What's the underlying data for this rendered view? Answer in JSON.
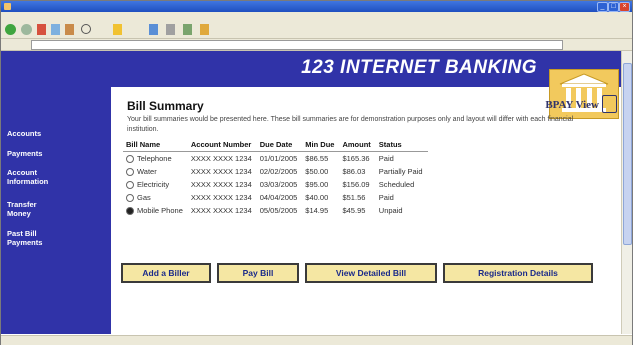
{
  "window": {
    "title": ""
  },
  "menu": [],
  "banner": {
    "title": "123 INTERNET BANKING"
  },
  "sidebar": {
    "items": [
      "Accounts",
      "Payments",
      "Account\nInformation",
      "Transfer\nMoney",
      "Past Bill\nPayments"
    ]
  },
  "main": {
    "heading": "Bill Summary",
    "bpay_label": "BPAY View",
    "description": "Your bill summaries would be presented here. These bill summaries are for demonstration purposes only and layout will differ with each financial institution."
  },
  "table": {
    "headers": [
      "Bill Name",
      "Account Number",
      "Due Date",
      "Min Due",
      "Amount",
      "Status"
    ],
    "rows": [
      {
        "name": "Telephone",
        "account": "XXXX XXXX 1234",
        "due": "01/01/2005",
        "min": "$86.55",
        "amount": "$165.36",
        "status": "Paid",
        "selected": false
      },
      {
        "name": "Water",
        "account": "XXXX XXXX 1234",
        "due": "02/02/2005",
        "min": "$50.00",
        "amount": "$86.03",
        "status": "Partially Paid",
        "selected": false
      },
      {
        "name": "Electricity",
        "account": "XXXX XXXX 1234",
        "due": "03/03/2005",
        "min": "$95.00",
        "amount": "$156.09",
        "status": "Scheduled",
        "selected": false
      },
      {
        "name": "Gas",
        "account": "XXXX XXXX 1234",
        "due": "04/04/2005",
        "min": "$40.00",
        "amount": "$51.56",
        "status": "Paid",
        "selected": false
      },
      {
        "name": "Mobile Phone",
        "account": "XXXX XXXX 1234",
        "due": "05/05/2005",
        "min": "$14.95",
        "amount": "$45.95",
        "status": "Unpaid",
        "selected": true
      }
    ]
  },
  "buttons": {
    "add_biller": "Add a Biller",
    "pay_bill": "Pay Bill",
    "view_detailed": "View Detailed Bill",
    "registration": "Registration Details"
  },
  "colors": {
    "brand": "#3033a8",
    "button_fill": "#f5e7a3",
    "button_text": "#1a2a8a",
    "banner_text": "#ffffff"
  },
  "icons": [
    "back-icon",
    "forward-icon",
    "stop-icon",
    "refresh-icon",
    "home-icon",
    "search-icon",
    "favorites-icon",
    "history-icon",
    "mail-icon",
    "print-icon",
    "edit-icon",
    "bank-building-icon",
    "bpay-icon"
  ]
}
